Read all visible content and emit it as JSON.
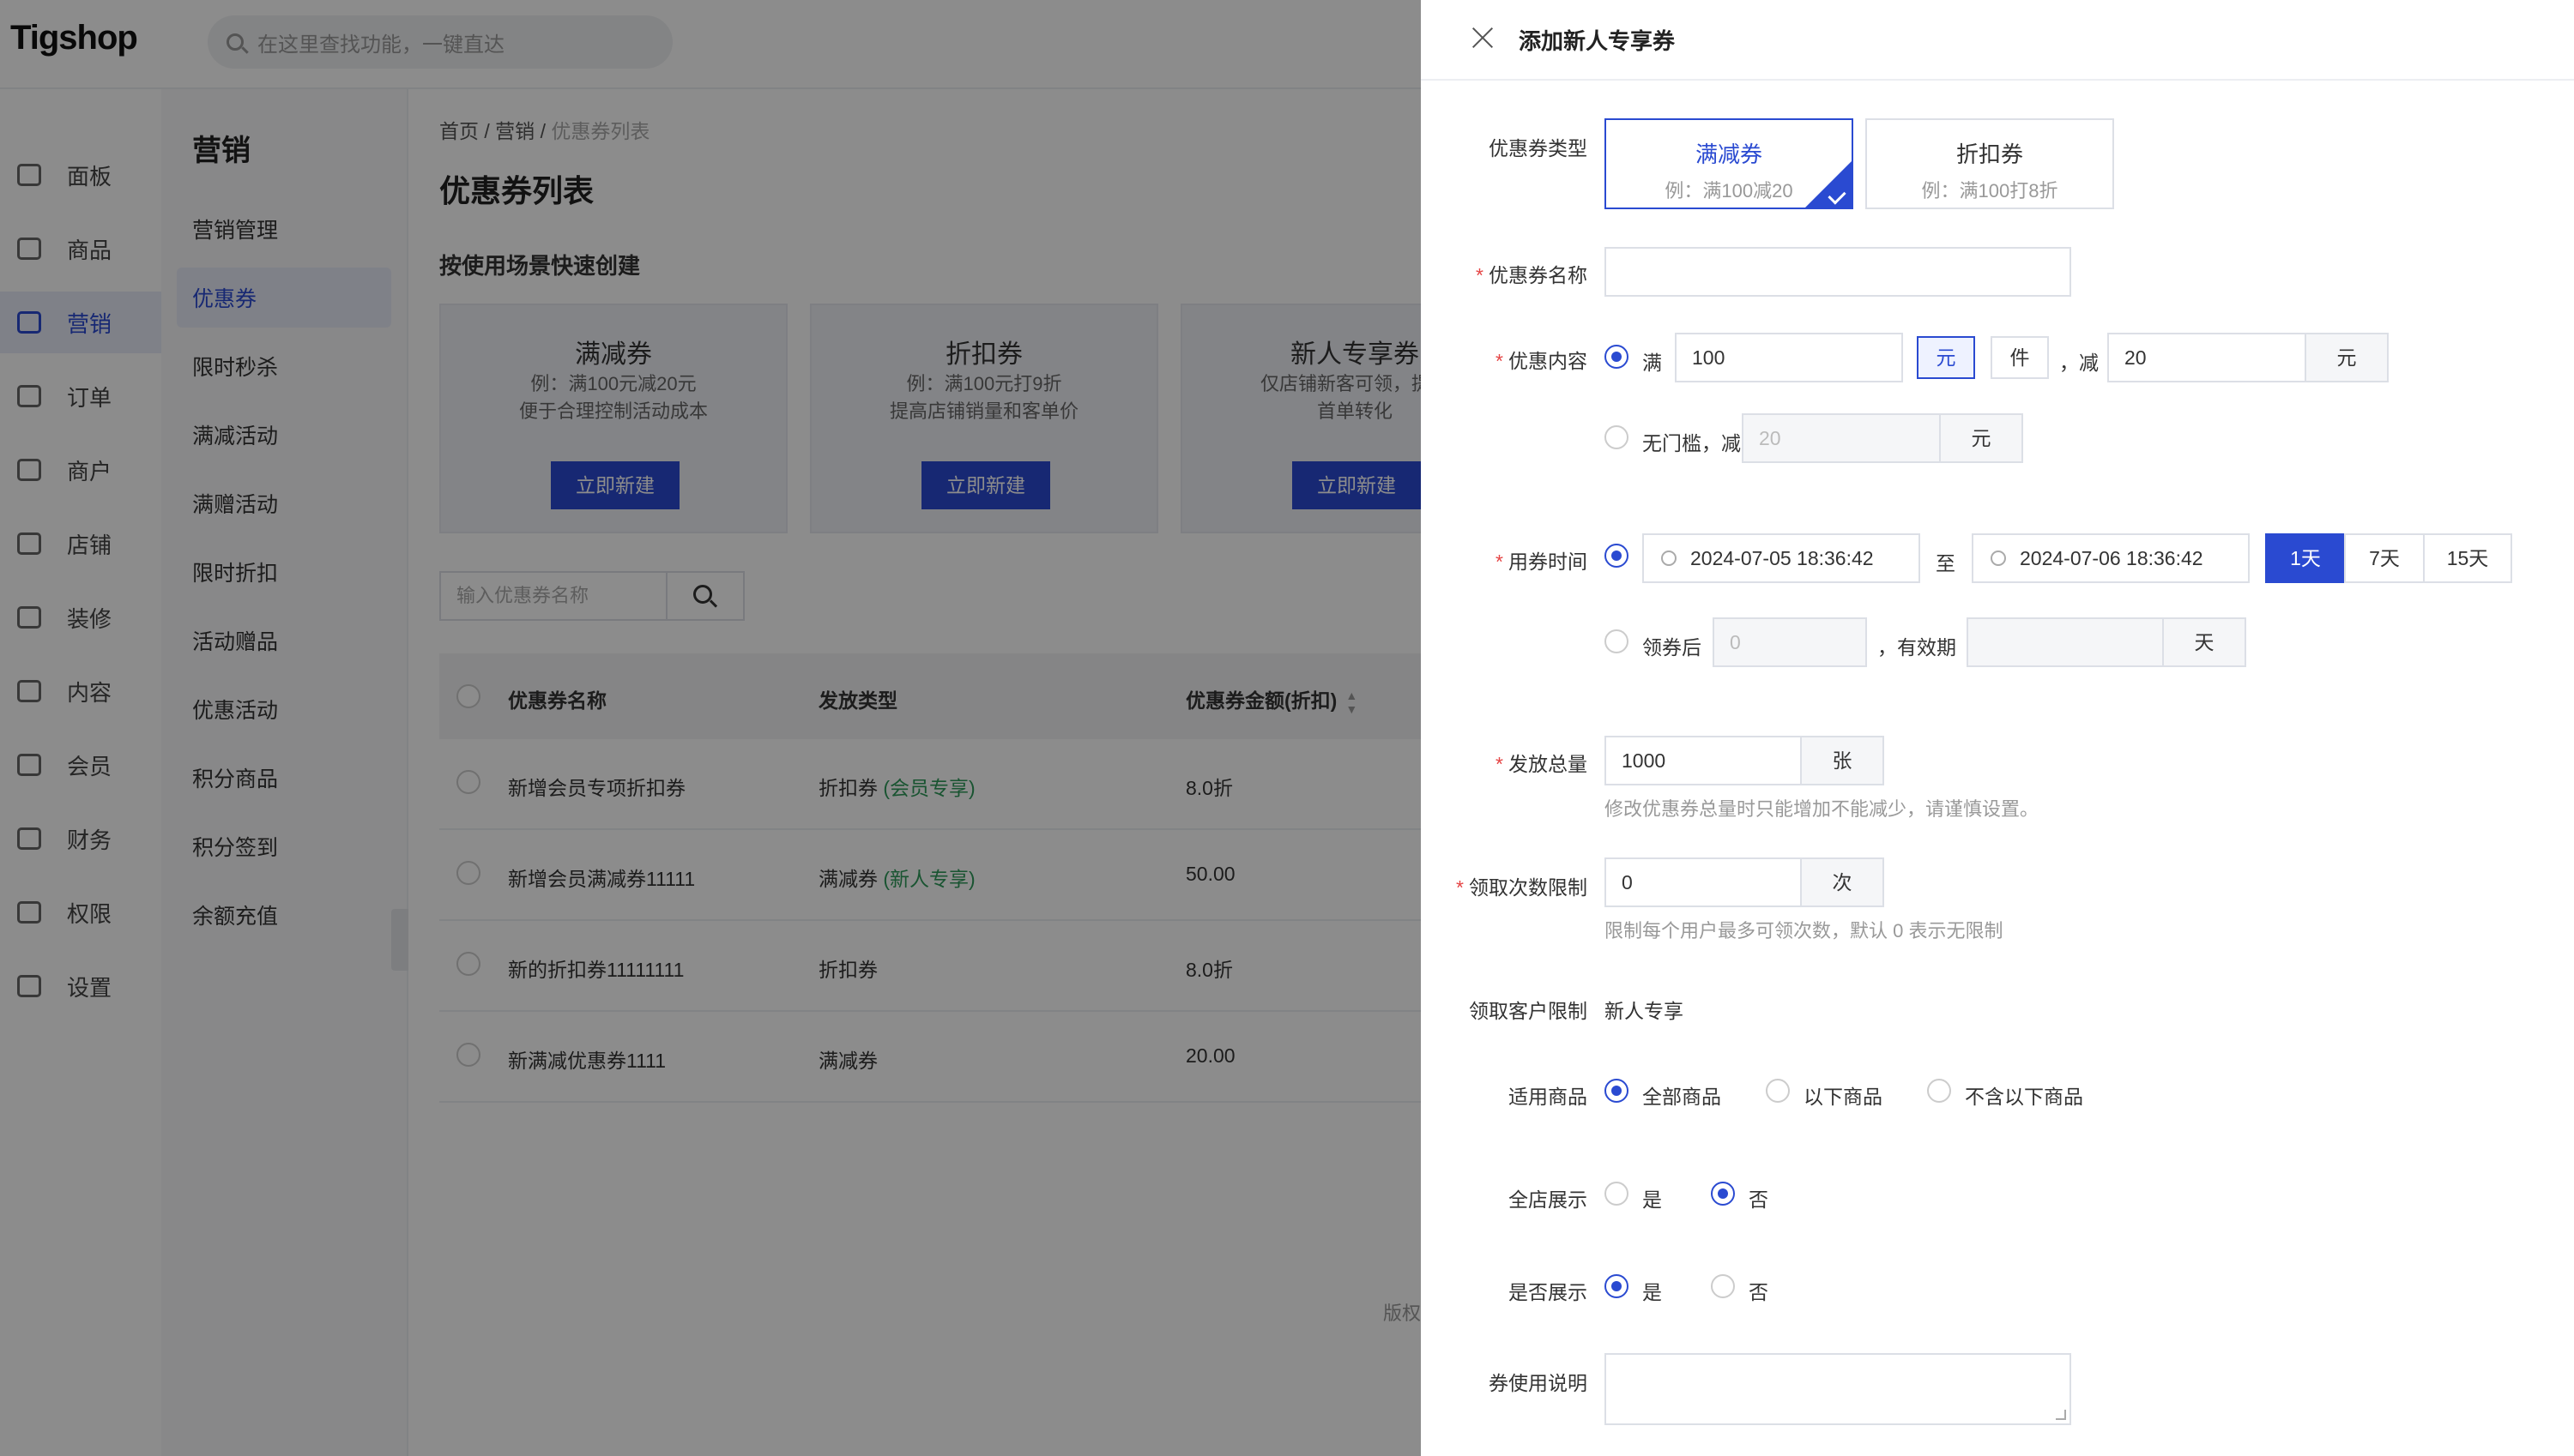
{
  "app": {
    "logo": "Tigshop",
    "search_placeholder": "在这里查找功能，一键直达"
  },
  "sidebar": {
    "items": [
      {
        "label": "面板",
        "icon": "dashboard-icon"
      },
      {
        "label": "商品",
        "icon": "box-icon"
      },
      {
        "label": "营销",
        "icon": "marketing-icon"
      },
      {
        "label": "订单",
        "icon": "order-icon"
      },
      {
        "label": "商户",
        "icon": "merchant-icon"
      },
      {
        "label": "店铺",
        "icon": "store-icon"
      },
      {
        "label": "装修",
        "icon": "decorate-icon"
      },
      {
        "label": "内容",
        "icon": "content-icon"
      },
      {
        "label": "会员",
        "icon": "member-icon"
      },
      {
        "label": "财务",
        "icon": "finance-icon"
      },
      {
        "label": "权限",
        "icon": "shield-icon"
      },
      {
        "label": "设置",
        "icon": "gear-icon"
      }
    ]
  },
  "subnav": {
    "title": "营销",
    "items": [
      "营销管理",
      "优惠券",
      "限时秒杀",
      "满减活动",
      "满赠活动",
      "限时折扣",
      "活动赠品",
      "优惠活动",
      "积分商品",
      "积分签到",
      "余额充值"
    ]
  },
  "main": {
    "breadcrumb": [
      "首页",
      "营销",
      "优惠券列表"
    ],
    "title": "优惠券列表",
    "quick_title": "按使用场景快速创建",
    "cards": [
      {
        "title": "满减券",
        "line1": "例：满100元减20元",
        "line2": "便于合理控制活动成本",
        "button": "立即新建"
      },
      {
        "title": "折扣券",
        "line1": "例：满100元打9折",
        "line2": "提高店铺销量和客单价",
        "button": "立即新建"
      },
      {
        "title": "新人专享券",
        "line1": "仅店铺新客可领，提高",
        "line2": "首单转化",
        "button": "立即新建"
      }
    ],
    "list_search_placeholder": "输入优惠券名称",
    "table": {
      "headers": [
        "优惠券名称",
        "发放类型",
        "优惠券金额(折扣)"
      ],
      "rows": [
        {
          "name": "新增会员专项折扣券",
          "type": "折扣券",
          "tag": "(会员专享)",
          "amount": "8.0折"
        },
        {
          "name": "新增会员满减券11111",
          "type": "满减券",
          "tag": "(新人专享)",
          "amount": "50.00"
        },
        {
          "name": "新的折扣券11111111",
          "type": "折扣券",
          "tag": "",
          "amount": "8.0折"
        },
        {
          "name": "新满减优惠券1111",
          "type": "满减券",
          "tag": "",
          "amount": "20.00"
        }
      ]
    },
    "footer": "版权"
  },
  "drawer": {
    "title": "添加新人专享券",
    "coupon_type": {
      "label": "优惠券类型",
      "options": [
        {
          "title": "满减券",
          "example": "例：满100减20"
        },
        {
          "title": "折扣券",
          "example": "例：满100打8折"
        }
      ]
    },
    "name": {
      "label": "优惠券名称",
      "value": ""
    },
    "content": {
      "label": "优惠内容",
      "man": "满",
      "min_value": "100",
      "unit_yuan": "元",
      "unit_jian": "件",
      "jian": "，减",
      "reduce_value": "20",
      "reduce_unit": "元",
      "no_threshold": "无门槛，减",
      "no_threshold_value": "20",
      "no_threshold_unit": "元"
    },
    "time": {
      "label": "用券时间",
      "start": "2024-07-05 18:36:42",
      "to": "至",
      "end": "2024-07-06 18:36:42",
      "quick": [
        "1天",
        "7天",
        "15天"
      ],
      "after_claim": "领券后",
      "after_value": "0",
      "valid_label": "，有效期",
      "valid_value": "",
      "valid_unit": "天"
    },
    "total": {
      "label": "发放总量",
      "value": "1000",
      "unit": "张",
      "hint": "修改优惠券总量时只能增加不能减少，请谨慎设置。"
    },
    "limit": {
      "label": "领取次数限制",
      "value": "0",
      "unit": "次",
      "hint": "限制每个用户最多可领次数，默认 0 表示无限制"
    },
    "customer": {
      "label": "领取客户限制",
      "value": "新人专享"
    },
    "goods": {
      "label": "适用商品",
      "options": [
        "全部商品",
        "以下商品",
        "不含以下商品"
      ]
    },
    "shop_display": {
      "label": "全店展示",
      "options": [
        "是",
        "否"
      ]
    },
    "display": {
      "label": "是否展示",
      "options": [
        "是",
        "否"
      ]
    },
    "desc": {
      "label": "券使用说明",
      "value": ""
    }
  },
  "colors": {
    "accent": "#2a4ad1",
    "tag_green": "#2e9a5a",
    "required": "#e54545"
  }
}
